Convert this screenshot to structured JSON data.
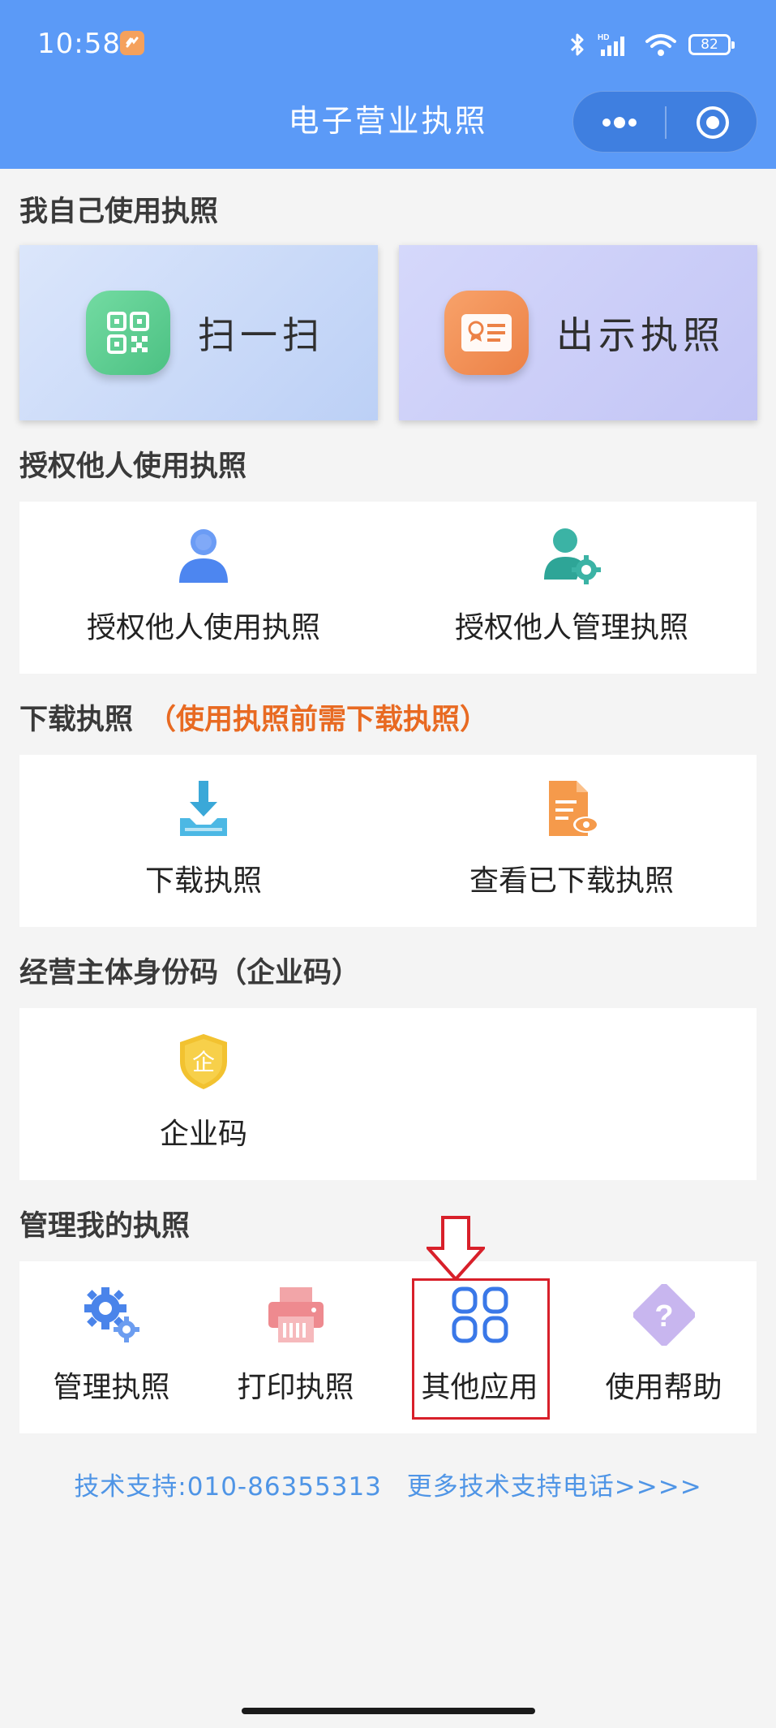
{
  "status_bar": {
    "time": "10:58",
    "battery": "82"
  },
  "header": {
    "title": "电子营业执照"
  },
  "section_self": {
    "title": "我自己使用执照",
    "scan_label": "扫一扫",
    "show_label": "出示执照"
  },
  "section_authorize": {
    "title": "授权他人使用执照",
    "items": [
      {
        "label": "授权他人使用执照",
        "icon": "person-icon"
      },
      {
        "label": "授权他人管理执照",
        "icon": "person-gear-icon"
      }
    ]
  },
  "section_download": {
    "title": "下载执照",
    "hint": "（使用执照前需下载执照）",
    "items": [
      {
        "label": "下载执照",
        "icon": "download-icon"
      },
      {
        "label": "查看已下载执照",
        "icon": "document-view-icon"
      }
    ]
  },
  "section_code": {
    "title": "经营主体身份码（企业码）",
    "items": [
      {
        "label": "企业码",
        "icon": "enterprise-shield-icon",
        "glyph": "企"
      }
    ]
  },
  "section_manage": {
    "title": "管理我的执照",
    "items": [
      {
        "label": "管理执照",
        "icon": "gears-icon"
      },
      {
        "label": "打印执照",
        "icon": "printer-icon"
      },
      {
        "label": "其他应用",
        "icon": "apps-grid-icon"
      },
      {
        "label": "使用帮助",
        "icon": "help-icon"
      }
    ]
  },
  "support": {
    "phone_text": "技术支持:010-86355313",
    "more_text": "更多技术支持电话>>>>"
  },
  "colors": {
    "header_bg": "#5b9af7",
    "hint": "#e86a22",
    "link": "#4f95e6",
    "highlight": "#d8202a"
  }
}
